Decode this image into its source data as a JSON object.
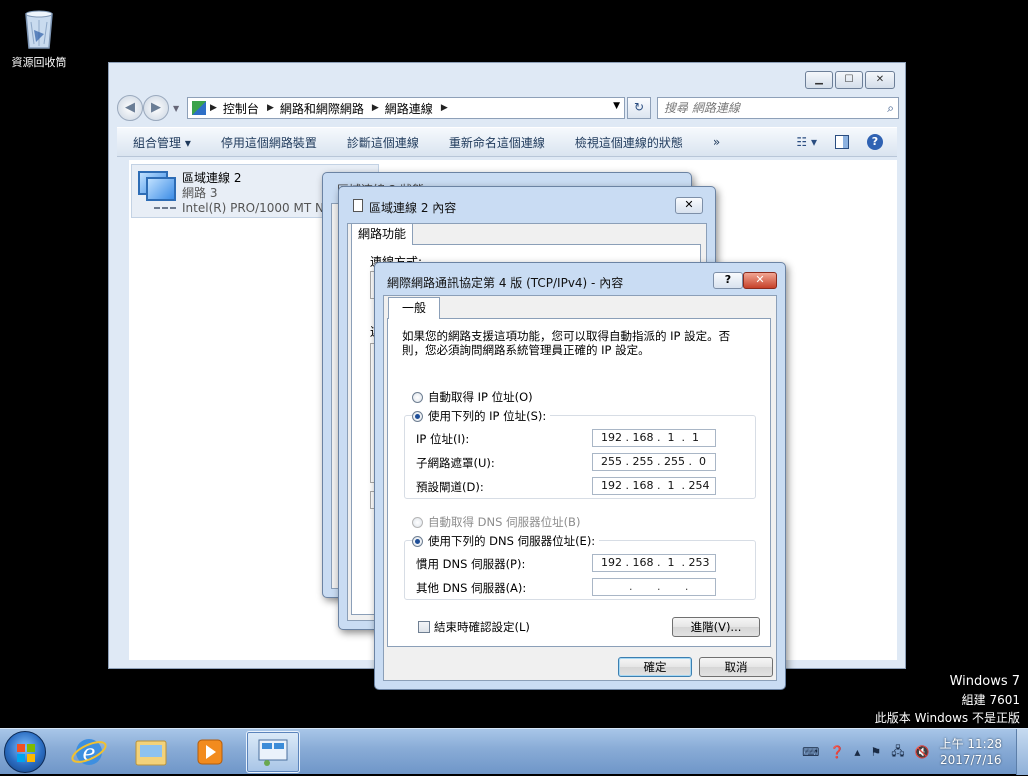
{
  "desktop": {
    "recycle_bin_label": "資源回收筒"
  },
  "explorer": {
    "address": {
      "crumbs": [
        "控制台",
        "網路和網際網路",
        "網路連線"
      ]
    },
    "search_placeholder": "搜尋 網路連線",
    "commands": [
      "組合管理 ▾",
      "停用這個網路裝置",
      "診斷這個連線",
      "重新命名這個連線",
      "檢視這個連線的狀態",
      "»"
    ],
    "connection": {
      "name": "區域連線 2",
      "network": "網路 3",
      "adapter": "Intel(R) PRO/1000 MT N"
    }
  },
  "status_dialog": {
    "title": "區域連線 2 狀態"
  },
  "props_dialog": {
    "title": "區域連線 2 內容",
    "tab": "網路功能",
    "connect_using": "連線方式:",
    "uses_partial": "連"
  },
  "tcp_dialog": {
    "title": "網際網路通訊協定第 4 版 (TCP/IPv4) - 內容",
    "help_label": "?",
    "close_label": "✕",
    "tab": "一般",
    "description": "如果您的網路支援這項功能，您可以取得自動指派的 IP 設定。否則，您必須詢問網路系統管理員正確的 IP 設定。",
    "auto_ip": "自動取得 IP 位址(O)",
    "use_ip": "使用下列的 IP 位址(S):",
    "ip_label": "IP 位址(I):",
    "ip_value": "192 . 168 .  1  .  1",
    "mask_label": "子網路遮罩(U):",
    "mask_value": "255 . 255 . 255 .  0",
    "gateway_label": "預設閘道(D):",
    "gateway_value": "192 . 168 .  1  . 254",
    "auto_dns": "自動取得 DNS 伺服器位址(B)",
    "use_dns": "使用下列的 DNS 伺服器位址(E):",
    "pref_dns_label": "慣用 DNS 伺服器(P):",
    "pref_dns_value": "192 . 168 .  1  . 253",
    "alt_dns_label": "其他 DNS 伺服器(A):",
    "alt_dns_value": "        .       .       .",
    "validate": "結束時確認設定(L)",
    "advanced": "進階(V)...",
    "ok": "確定",
    "cancel": "取消"
  },
  "watermark": {
    "line1": "Windows 7",
    "line2": "組建 7601",
    "line3": "此版本 Windows 不是正版"
  },
  "taskbar": {
    "time_prefix": "上午",
    "time": "11:28",
    "date": "2017/7/16"
  },
  "colors": {
    "taskbar": "#88abd6",
    "dialog_frame": "#c9dcf3",
    "close_red": "#c6412a"
  }
}
